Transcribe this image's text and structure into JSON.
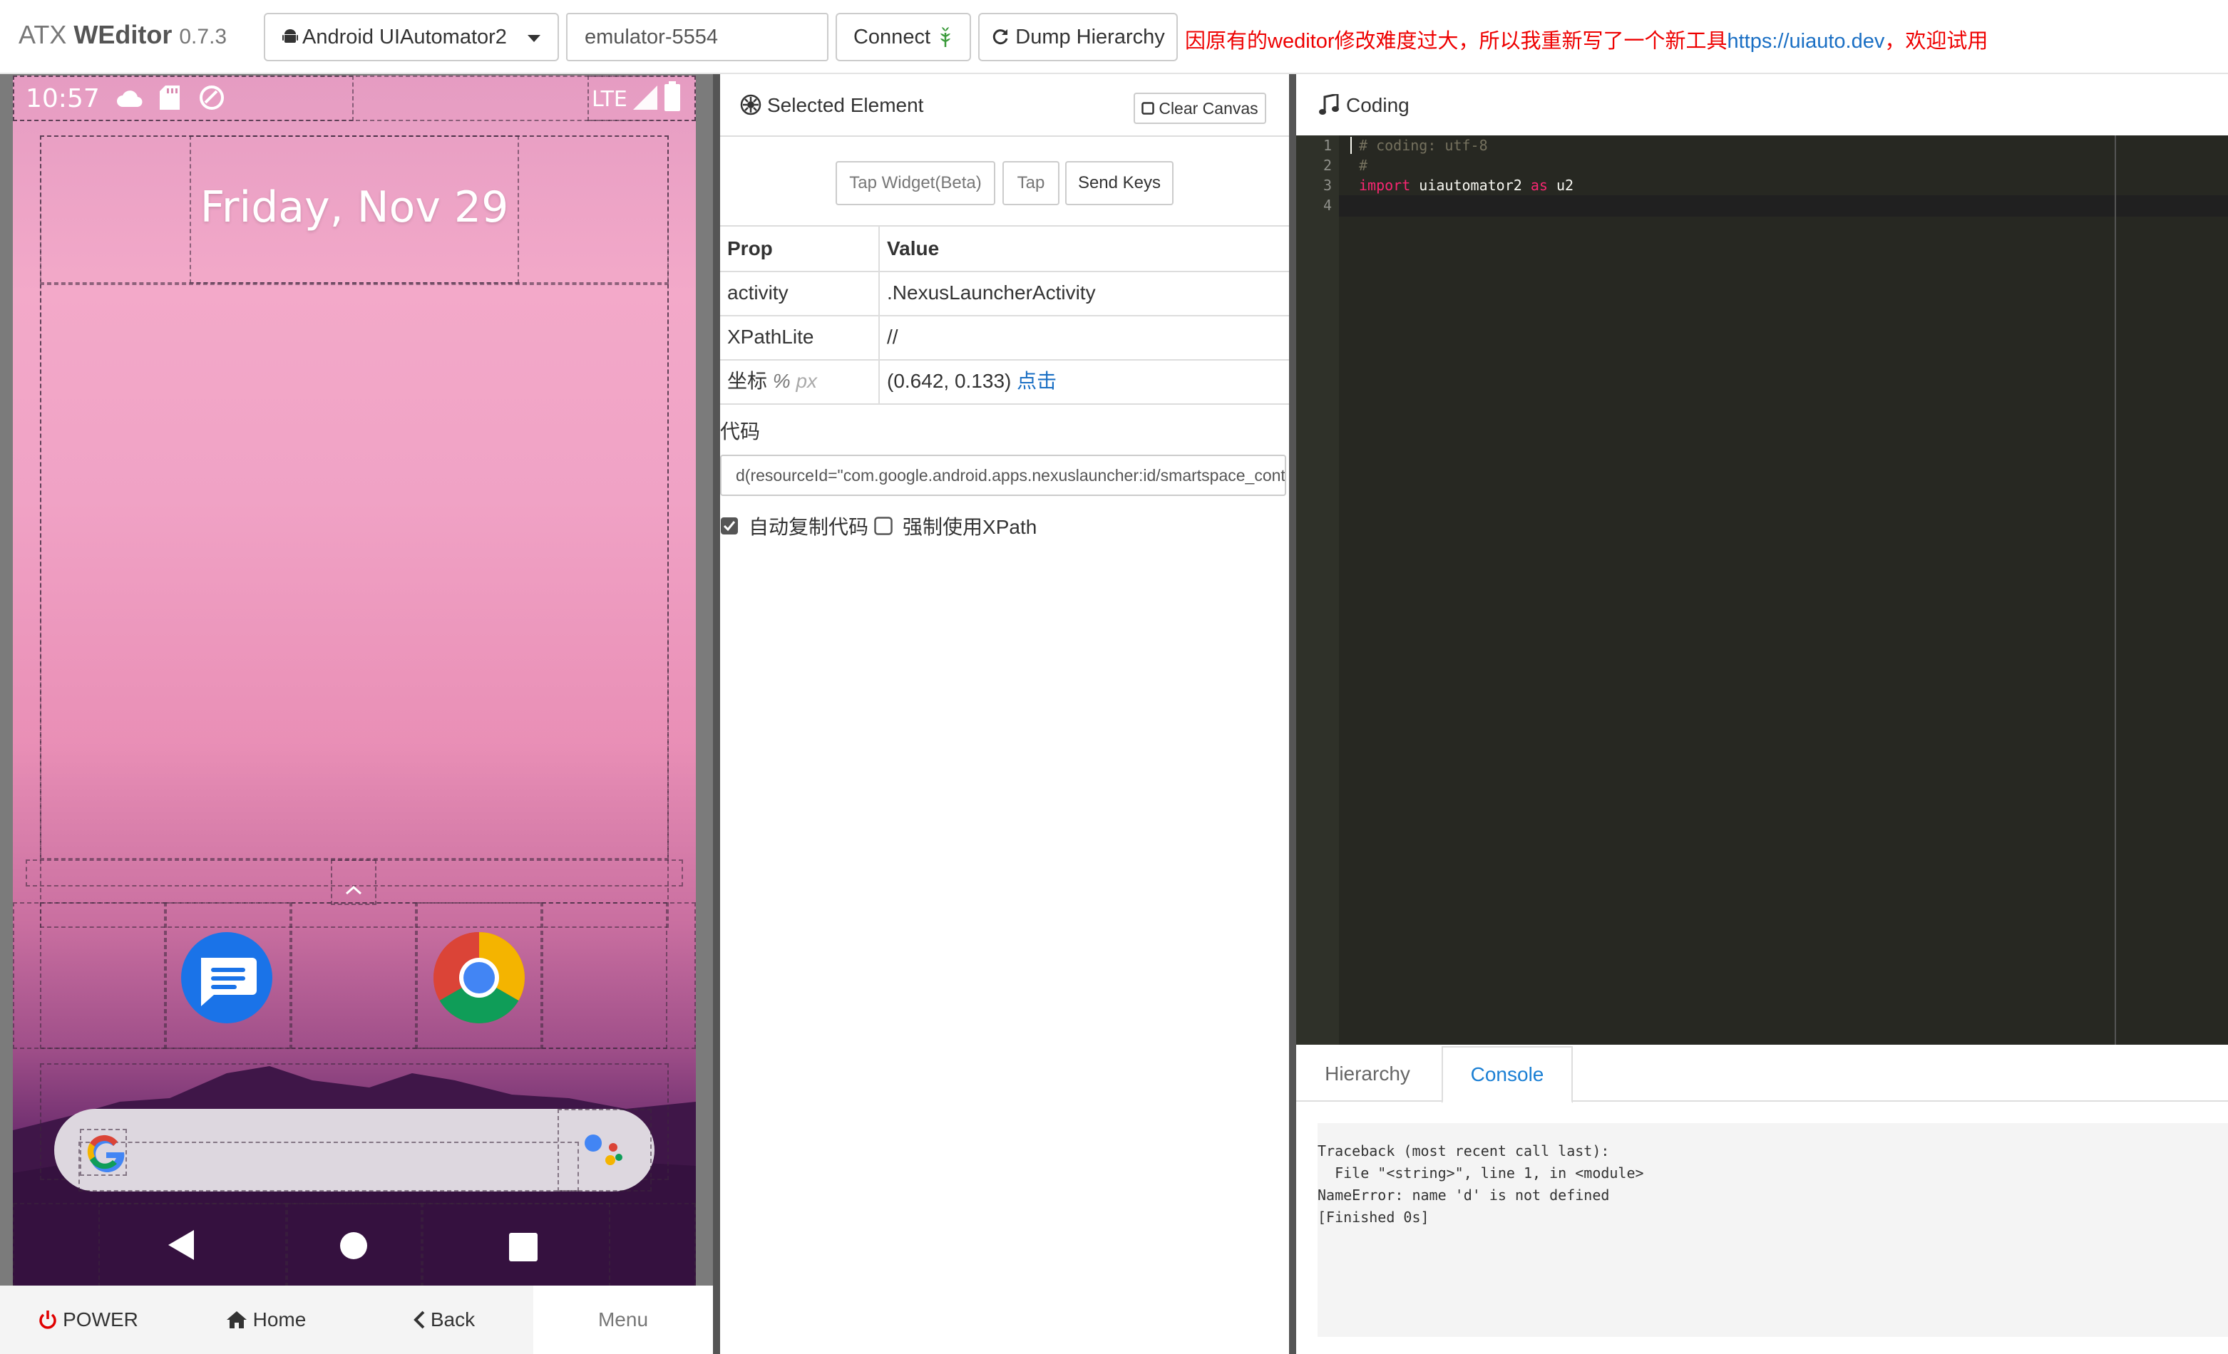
{
  "app": {
    "name_prefix": "ATX",
    "name_bold": "WEditor",
    "version": "0.7.3"
  },
  "toolbar": {
    "platform_select": "Android UIAutomator2",
    "device_serial": "emulator-5554",
    "connect_label": "Connect",
    "dump_label": "Dump Hierarchy",
    "notice_text": "因原有的weditor修改难度过大，所以我重新写了一个新工具",
    "notice_link": "https://uiauto.dev",
    "notice_suffix": "，欢迎试用"
  },
  "phone": {
    "status_time": "10:57",
    "network": "LTE",
    "date_widget": "Friday, Nov 29",
    "bottom_buttons": {
      "power": "POWER",
      "home": "Home",
      "back": "Back",
      "menu": "Menu"
    }
  },
  "selected_element": {
    "title": "Selected Element",
    "clear_canvas": "Clear Canvas",
    "actions": {
      "tap_widget": "Tap Widget(Beta)",
      "tap": "Tap",
      "send_keys": "Send Keys"
    },
    "table": {
      "head_prop": "Prop",
      "head_value": "Value",
      "rows": [
        {
          "prop": "activity",
          "value": ".NexusLauncherActivity"
        },
        {
          "prop": "XPathLite",
          "value": "//"
        }
      ],
      "coord_label": "坐标",
      "coord_units_pct": "%",
      "coord_units_px": "px",
      "coord_value": "(0.642, 0.133)",
      "coord_click": "点击"
    },
    "code_label": "代码",
    "code_value": "d(resourceId=\"com.google.android.apps.nexuslauncher:id/smartspace_content\")",
    "auto_copy_label": "自动复制代码",
    "auto_copy_checked": true,
    "force_xpath_label": "强制使用XPath",
    "force_xpath_checked": false
  },
  "coding": {
    "title": "Coding",
    "line_numbers": [
      "1",
      "2",
      "3",
      "4"
    ],
    "lines": {
      "l1": "# coding: utf-8",
      "l2": "#",
      "l3_kw": "import",
      "l3_mod": " uiautomator2 ",
      "l3_as": "as",
      "l3_alias": " u2"
    }
  },
  "bottom_tabs": {
    "hierarchy": "Hierarchy",
    "console": "Console",
    "active": "Console"
  },
  "console": {
    "lines": [
      "Traceback (most recent call last):",
      "  File \"<string>\", line 1, in <module>",
      "NameError: name 'd' is not defined",
      "[Finished 0s]"
    ]
  },
  "colors": {
    "notice_red": "#ee0000",
    "link_blue": "#1a6fc4",
    "editor_bg": "#272822",
    "keyword_pink": "#f92672",
    "power_red": "#e00000"
  }
}
